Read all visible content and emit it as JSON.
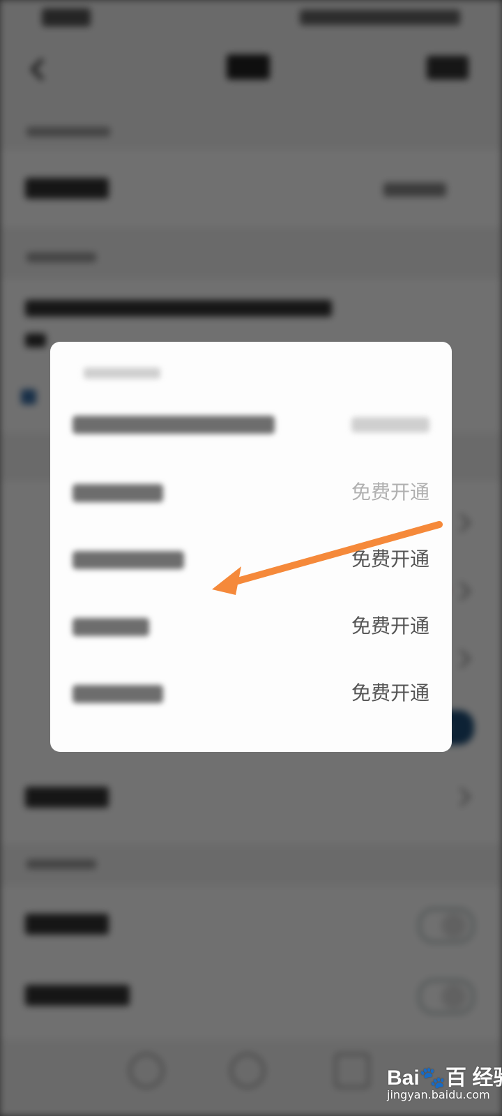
{
  "dialog": {
    "header": "",
    "rows": [
      {
        "label": "",
        "action": ""
      },
      {
        "label": "",
        "action": "免费开通"
      },
      {
        "label": "",
        "action": "免费开通"
      },
      {
        "label": "",
        "action": "免费开通"
      },
      {
        "label": "",
        "action": "免费开通"
      }
    ]
  },
  "annotation": {
    "arrow_color": "#f5893a"
  },
  "watermark": {
    "brand": "Bai🐾百 经验",
    "url": "jingyan.baidu.com"
  },
  "colors": {
    "dialog_bg": "#fdfdfd",
    "scrim": "rgba(0,0,0,0.56)",
    "toggle_on": "#1f4e79"
  }
}
